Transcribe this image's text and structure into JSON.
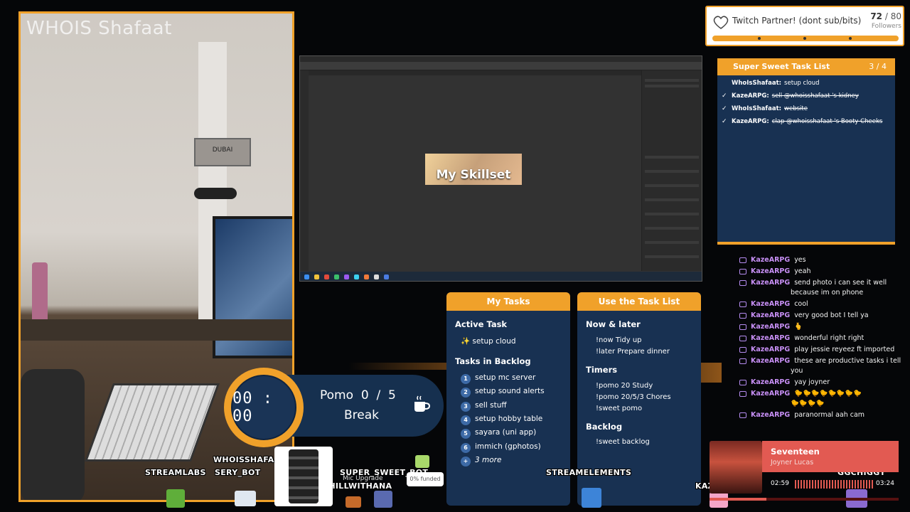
{
  "webcam": {
    "title": "WHOIS Shafaat",
    "sign_text": "DUBAI"
  },
  "photoshop": {
    "canvas_text": "My Skillset"
  },
  "partner": {
    "title": "Twitch Partner! (dont sub/bits)",
    "current": "72",
    "total": "/ 80",
    "label": "Followers"
  },
  "sstl": {
    "title": "Super Sweet Task List",
    "count": "3 / 4",
    "items": [
      {
        "user": "WhoIsShafaat:",
        "task": "setup cloud",
        "done": false
      },
      {
        "user": "KazeARPG:",
        "task": "sell @whoisshafaat 's kidney",
        "done": true
      },
      {
        "user": "WhoIsShafaat:",
        "task": "website",
        "done": true
      },
      {
        "user": "KazeARPG:",
        "task": "clap @whoisshafaat 's Booty Cheeks",
        "done": true
      }
    ]
  },
  "chat": [
    {
      "user": "KazeARPG",
      "text": "yes"
    },
    {
      "user": "KazeARPG",
      "text": "yeah"
    },
    {
      "user": "KazeARPG",
      "text": "send photo i can see it well",
      "text2": "because im on phone"
    },
    {
      "user": "KazeARPG",
      "text": "cool"
    },
    {
      "user": "KazeARPG",
      "text": "very good bot I tell ya"
    },
    {
      "user": "KazeARPG",
      "text": "🫰"
    },
    {
      "user": "KazeARPG",
      "text": "wonderful right right"
    },
    {
      "user": "KazeARPG",
      "text": "play jessie reyeez ft imported"
    },
    {
      "user": "KazeARPG",
      "text": "these are productive tasks i tell",
      "text2": "you"
    },
    {
      "user": "KazeARPG",
      "text": "yay joyner"
    },
    {
      "user": "KazeARPG",
      "text": "🐤🐤🐤🐤🐤🐤🐤🐤",
      "text2": "🐤🐤🐤🐤"
    },
    {
      "user": "KazeARPG",
      "text": "paranormal aah cam"
    }
  ],
  "pomo": {
    "time": "00 : 00",
    "label": "Pomo",
    "current": "0",
    "sep": "/",
    "total": "5",
    "state": "Break"
  },
  "my_tasks": {
    "title": "My Tasks",
    "active_heading": "Active Task",
    "active": "✨ setup cloud",
    "backlog_heading": "Tasks in Backlog",
    "backlog": [
      {
        "n": "1",
        "t": "setup mc server"
      },
      {
        "n": "2",
        "t": "setup sound alerts"
      },
      {
        "n": "3",
        "t": "sell stuff"
      },
      {
        "n": "4",
        "t": "setup hobby table"
      },
      {
        "n": "5",
        "t": "sayara (uni app)"
      },
      {
        "n": "6",
        "t": "immich (gphotos)"
      },
      {
        "n": "+",
        "t": "3 more"
      }
    ]
  },
  "use_list": {
    "title": "Use the Task List",
    "now_heading": "Now & later",
    "now": [
      "!now Tidy up",
      "!later Prepare dinner"
    ],
    "timers_heading": "Timers",
    "timers": [
      "!pomo 20 Study",
      "!pomo 20/5/3 Chores",
      "!sweet pomo"
    ],
    "backlog_heading": "Backlog",
    "backlog": [
      "!sweet backlog"
    ]
  },
  "bottom": {
    "names": [
      "STREAMLABS",
      "WHOISSHAFAAT",
      "SERY_BOT",
      "SUPER_SWEET_BOT",
      "CHILLWITHANA",
      "STREAMELEMENTS",
      "KAZEARPG",
      "GGCHIGGY"
    ],
    "mic": "Mic Upgrade",
    "funded": "0% funded"
  },
  "music": {
    "song": "Seventeen",
    "artist": "Joyner Lucas",
    "elapsed": "02:59",
    "length": "03:24"
  },
  "colors": {
    "accent": "#f0a12a",
    "panel": "#183152",
    "chat_user": "#c78ff5",
    "music": "#e25a52"
  }
}
